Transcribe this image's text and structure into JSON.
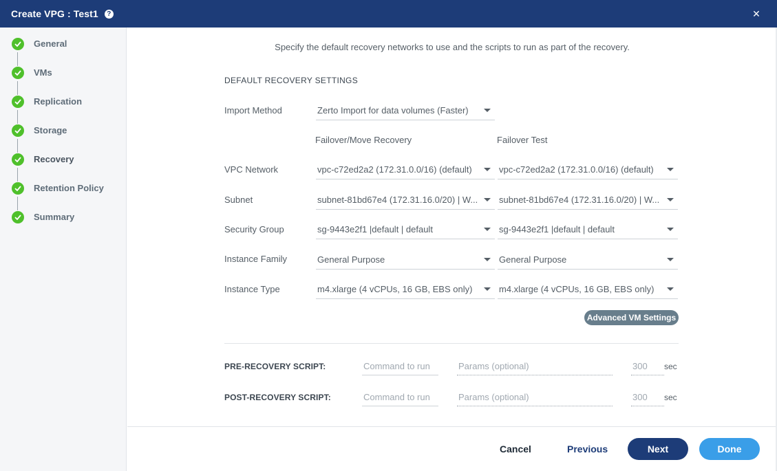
{
  "window": {
    "title": "Create VPG : Test1",
    "help_icon": "question-circle-icon",
    "close_icon": "close-icon"
  },
  "steps": [
    {
      "label": "General",
      "status": "complete"
    },
    {
      "label": "VMs",
      "status": "complete"
    },
    {
      "label": "Replication",
      "status": "complete"
    },
    {
      "label": "Storage",
      "status": "complete"
    },
    {
      "label": "Recovery",
      "status": "complete",
      "current": true
    },
    {
      "label": "Retention Policy",
      "status": "complete"
    },
    {
      "label": "Summary",
      "status": "complete"
    }
  ],
  "intro": "Specify the default recovery networks to use and the scripts to run as part of the recovery.",
  "section_title": "DEFAULT RECOVERY SETTINGS",
  "import_method": {
    "label": "Import Method",
    "value": "Zerto Import for data volumes (Faster)"
  },
  "columns": {
    "failover": "Failover/Move Recovery",
    "test": "Failover Test"
  },
  "rows": {
    "vpc": {
      "label": "VPC Network",
      "failover": "vpc-c72ed2a2 (172.31.0.0/16) (default)",
      "test": "vpc-c72ed2a2 (172.31.0.0/16) (default)"
    },
    "subnet": {
      "label": "Subnet",
      "failover": "subnet-81bd67e4 (172.31.16.0/20) | W...",
      "test": "subnet-81bd67e4 (172.31.16.0/20) | W..."
    },
    "security": {
      "label": "Security Group",
      "failover": "sg-9443e2f1 |default | default",
      "test": "sg-9443e2f1 |default | default"
    },
    "family": {
      "label": "Instance Family",
      "failover": "General Purpose",
      "test": "General Purpose"
    },
    "type": {
      "label": "Instance Type",
      "failover": "m4.xlarge (4 vCPUs, 16 GB, EBS only)",
      "test": "m4.xlarge (4 vCPUs, 16 GB, EBS only)"
    }
  },
  "advanced_button": "Advanced VM Settings",
  "pre_script": {
    "label": "PRE-RECOVERY SCRIPT:",
    "command_placeholder": "Command to run",
    "params_placeholder": "Params (optional)",
    "timeout_placeholder": "300",
    "unit": "sec"
  },
  "post_script": {
    "label": "POST-RECOVERY SCRIPT:",
    "command_placeholder": "Command to run",
    "params_placeholder": "Params (optional)",
    "timeout_placeholder": "300",
    "unit": "sec"
  },
  "footer": {
    "cancel": "Cancel",
    "previous": "Previous",
    "next": "Next",
    "done": "Done"
  },
  "colors": {
    "header": "#1d3c78",
    "check": "#4fc02b",
    "next": "#1d3c78",
    "done": "#3a9ee8",
    "advanced": "#687e8c"
  }
}
